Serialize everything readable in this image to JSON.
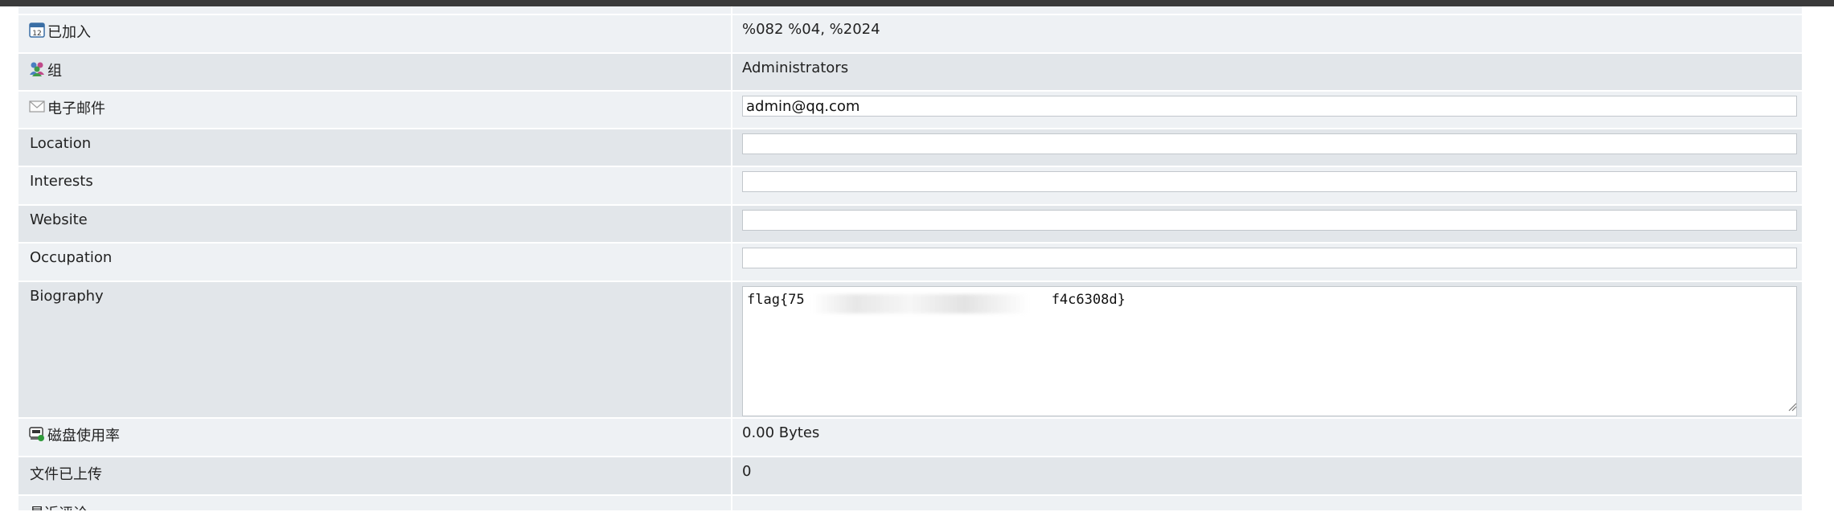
{
  "profile_fields": {
    "joined": {
      "icon": "calendar-icon",
      "label": "已加入",
      "value": "%082 %04, %2024"
    },
    "groups": {
      "icon": "group-users-icon",
      "label": "组",
      "value": "Administrators"
    },
    "email": {
      "icon": "envelope-icon",
      "label": "电子邮件",
      "value": "admin@qq.com"
    },
    "location": {
      "label": "Location",
      "value": ""
    },
    "interests": {
      "label": "Interests",
      "value": ""
    },
    "website": {
      "label": "Website",
      "value": ""
    },
    "occupation": {
      "label": "Occupation",
      "value": ""
    },
    "biography": {
      "label": "Biography",
      "value": "flag{75                              f4c6308d}"
    },
    "disk_usage": {
      "icon": "disk-usage-icon",
      "label": "磁盘使用率",
      "value": "0.00 Bytes"
    },
    "files_uploaded": {
      "label": "文件已上传",
      "value": "0"
    },
    "recent_comments": {
      "label": "最近评论"
    }
  },
  "colors": {
    "row_light": "#eef1f4",
    "row_dark": "#e2e6ea",
    "top_bar": "#3a3a3a"
  }
}
